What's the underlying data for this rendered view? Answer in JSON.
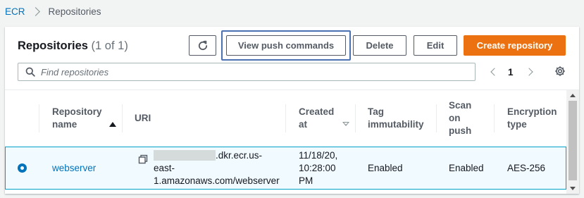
{
  "breadcrumb": {
    "root": "ECR",
    "current": "Repositories"
  },
  "panel": {
    "title": "Repositories",
    "count": "(1 of 1)",
    "buttons": {
      "view_push": "View push commands",
      "delete": "Delete",
      "edit": "Edit",
      "create": "Create repository"
    }
  },
  "search": {
    "placeholder": "Find repositories",
    "value": ""
  },
  "pagination": {
    "current_page": "1"
  },
  "table": {
    "columns": [
      {
        "line1": "Repository",
        "line2": "name",
        "line3": "",
        "sort": "ascending"
      },
      {
        "line1": "URI",
        "line2": "",
        "line3": "",
        "sort": ""
      },
      {
        "line1": "Created",
        "line2": "at",
        "line3": "",
        "sort": "descending"
      },
      {
        "line1": "Tag",
        "line2": "immutability",
        "line3": "",
        "sort": ""
      },
      {
        "line1": "Scan",
        "line2": "on",
        "line3": "push",
        "sort": ""
      },
      {
        "line1": "Encryption",
        "line2": "type",
        "line3": "",
        "sort": ""
      }
    ],
    "rows": [
      {
        "selected": true,
        "name": "webserver",
        "uri_line1_suffix": ".dkr.ecr.us-",
        "uri_line2": "east-",
        "uri_line3": "1.amazonaws.com/webserver",
        "created_line1": "11/18/20,",
        "created_line2": "10:28:00",
        "created_line3": "PM",
        "tag_immutability": "Enabled",
        "scan_on_push": "Enabled",
        "encryption": "AES-256"
      }
    ]
  },
  "colors": {
    "accent_orange": "#ec7211",
    "link_blue": "#0073bb",
    "selected_row_bg": "#f1faff",
    "selected_row_border": "#00a1c9",
    "focus_ring": "#4a72b2"
  },
  "icons": [
    "refresh-icon",
    "search-icon",
    "chevron-left-icon",
    "chevron-right-icon",
    "settings-icon",
    "copy-icon",
    "sort-ascending-icon",
    "sort-descending-icon"
  ]
}
